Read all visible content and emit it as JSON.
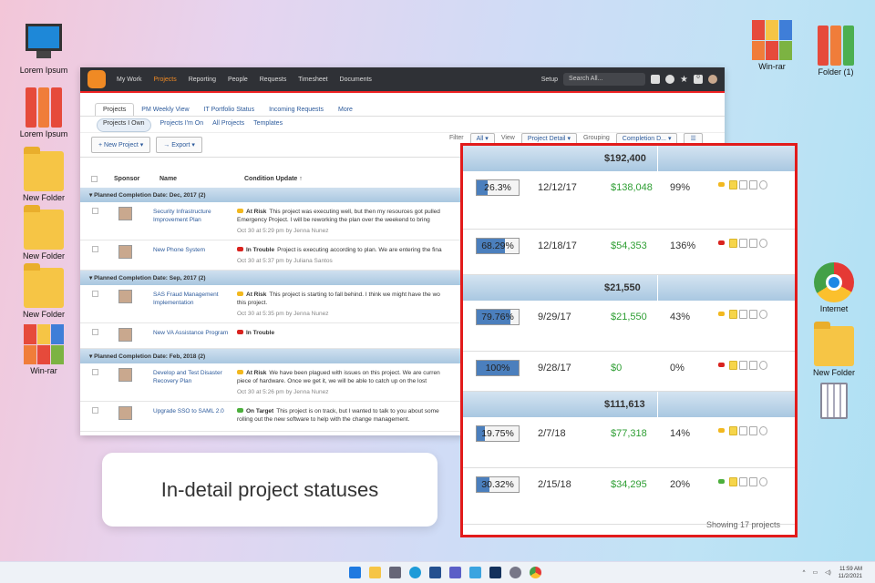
{
  "desktop": {
    "left": [
      {
        "label": "Lorem Ipsum",
        "icon": "computer-icon"
      },
      {
        "label": "Lorem Ipsum",
        "icon": "binders-icon"
      },
      {
        "label": "New Folder",
        "icon": "folder-icon"
      },
      {
        "label": "New Folder",
        "icon": "folder-icon"
      },
      {
        "label": "New Folder",
        "icon": "folder-icon"
      },
      {
        "label": "Win-rar",
        "icon": "winrar-icon"
      }
    ],
    "right": [
      {
        "label": "Win-rar"
      },
      {
        "label": "Folder (1)"
      },
      {
        "label": "Internet"
      },
      {
        "label": "New Folder"
      }
    ]
  },
  "app": {
    "nav": [
      "My Work",
      "Projects",
      "Reporting",
      "People",
      "Requests",
      "Timesheet",
      "Documents"
    ],
    "setup": "Setup",
    "search_placeholder": "Search All...",
    "notif_count": "0",
    "tabs": [
      "Projects",
      "PM Weekly View",
      "IT Portfolio Status",
      "Incoming Requests",
      "More"
    ],
    "subtabs": [
      "Projects I Own",
      "Projects I'm On",
      "All Projects",
      "Templates"
    ],
    "toolbar": {
      "new_project": "New Project",
      "export": "Export",
      "filter_label": "Filter",
      "filter": "All",
      "view_label": "View",
      "view": "Project Detail",
      "grouping_label": "Grouping",
      "grouping": "Completion D..."
    },
    "columns": [
      "Sponsor",
      "Name",
      "Condition Update ↑"
    ],
    "groups": [
      {
        "title": "Planned Completion Date: Dec, 2017 (2)",
        "rows": [
          {
            "name": "Security Infrastructure Improvement Plan",
            "status": "At Risk",
            "text": "This project was executing well, but then my resources got pulled",
            "text2": "Emergency Project. I will be reworking the plan over the weekend to bring",
            "meta": "Oct 30 at 5:29 pm by Jenna Nunez",
            "color": "#f2b81f"
          },
          {
            "name": "New Phone System",
            "status": "In Trouble",
            "text": "Project is executing according to plan. We are entering the fina",
            "text2": "",
            "meta": "Oct 30 at 5:37 pm by Juliana Santos",
            "color": "#d9231f"
          }
        ]
      },
      {
        "title": "Planned Completion Date: Sep, 2017 (2)",
        "rows": [
          {
            "name": "SAS Fraud Management Implementation",
            "status": "At Risk",
            "text": "This project is starting to fall behind. I think we might have the wo",
            "text2": "this project.",
            "meta": "Oct 30 at 5:35 pm by Jenna Nunez",
            "color": "#f2b81f"
          },
          {
            "name": "New VA Assistance Program",
            "status": "In Trouble",
            "text": "",
            "text2": "",
            "meta": "",
            "color": "#d9231f"
          }
        ]
      },
      {
        "title": "Planned Completion Date: Feb, 2018 (2)",
        "rows": [
          {
            "name": "Develop and Test Disaster Recovery Plan",
            "status": "At Risk",
            "text": "We have been plagued with issues on this project. We are curren",
            "text2": "piece of hardware. Once we get it, we will be able to catch up on the lost",
            "meta": "Oct 30 at 5:26 pm by Jenna Nunez",
            "color": "#f2b81f"
          },
          {
            "name": "Upgrade SSO to SAML 2.0",
            "status": "On Target",
            "text": "This project is on track, but I wanted to talk to you about some",
            "text2": "rolling out the new software to help with the change management.",
            "meta": "",
            "color": "#4caf3c"
          }
        ]
      }
    ]
  },
  "zoom": {
    "groups": [
      {
        "total": "$192,400",
        "rows": [
          {
            "progress": 26.3,
            "label": "26.3%",
            "date": "12/12/17",
            "amount": "$138,048",
            "pct": "99%",
            "flag": "#f2b81f"
          },
          {
            "progress": 68.29,
            "label": "68.29%",
            "date": "12/18/17",
            "amount": "$54,353",
            "pct": "136%",
            "flag": "#d9231f"
          }
        ]
      },
      {
        "total": "$21,550",
        "rows": [
          {
            "progress": 79.76,
            "label": "79.76%",
            "date": "9/29/17",
            "amount": "$21,550",
            "pct": "43%",
            "flag": "#f2b81f"
          },
          {
            "progress": 100,
            "label": "100%",
            "date": "9/28/17",
            "amount": "$0",
            "pct": "0%",
            "flag": "#d9231f"
          }
        ]
      },
      {
        "total": "$111,613",
        "rows": [
          {
            "progress": 19.75,
            "label": "19.75%",
            "date": "2/7/18",
            "amount": "$77,318",
            "pct": "14%",
            "flag": "#f2b81f"
          },
          {
            "progress": 30.32,
            "label": "30.32%",
            "date": "2/15/18",
            "amount": "$34,295",
            "pct": "20%",
            "flag": "#4caf3c"
          }
        ]
      }
    ],
    "footer": "Showing 17 projects"
  },
  "callout": "In-detail project statuses",
  "clock": {
    "time": "11:59 AM",
    "date": "11/2/2021"
  }
}
